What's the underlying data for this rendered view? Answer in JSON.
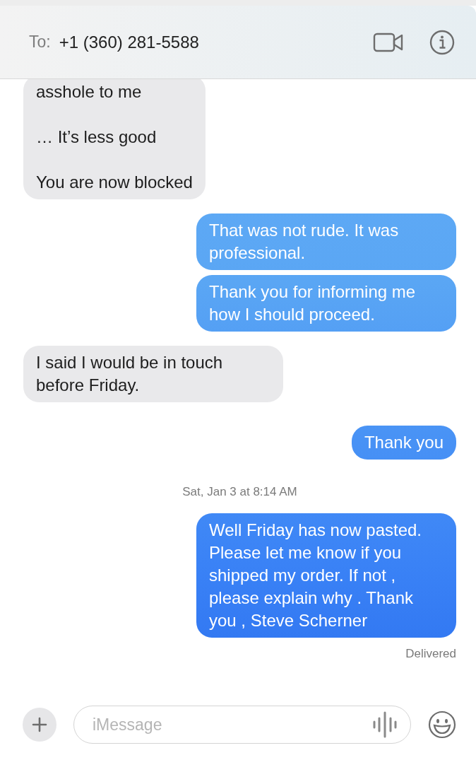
{
  "header": {
    "to_label": "To:",
    "recipient": "+1 (360) 281-5588"
  },
  "messages": [
    {
      "kind": "received",
      "text": "asshole to me\n\n… It’s less good\n\nYou are now blocked"
    },
    {
      "kind": "sent",
      "text": "That was not rude. It was professional."
    },
    {
      "kind": "sent",
      "text": "Thank you for informing me how I should proceed."
    },
    {
      "kind": "received",
      "text": "I said I would be in touch before Friday."
    },
    {
      "kind": "sent",
      "text": "Thank you"
    },
    {
      "kind": "timestamp",
      "text": "Sat, Jan 3 at 8:14 AM"
    },
    {
      "kind": "sent",
      "text": "Well Friday has now pasted. Please let me know if you shipped my order. If not , please explain why . Thank you , Steve Scherner"
    },
    {
      "kind": "status",
      "text": "Delivered"
    }
  ],
  "composer": {
    "placeholder": "iMessage"
  }
}
